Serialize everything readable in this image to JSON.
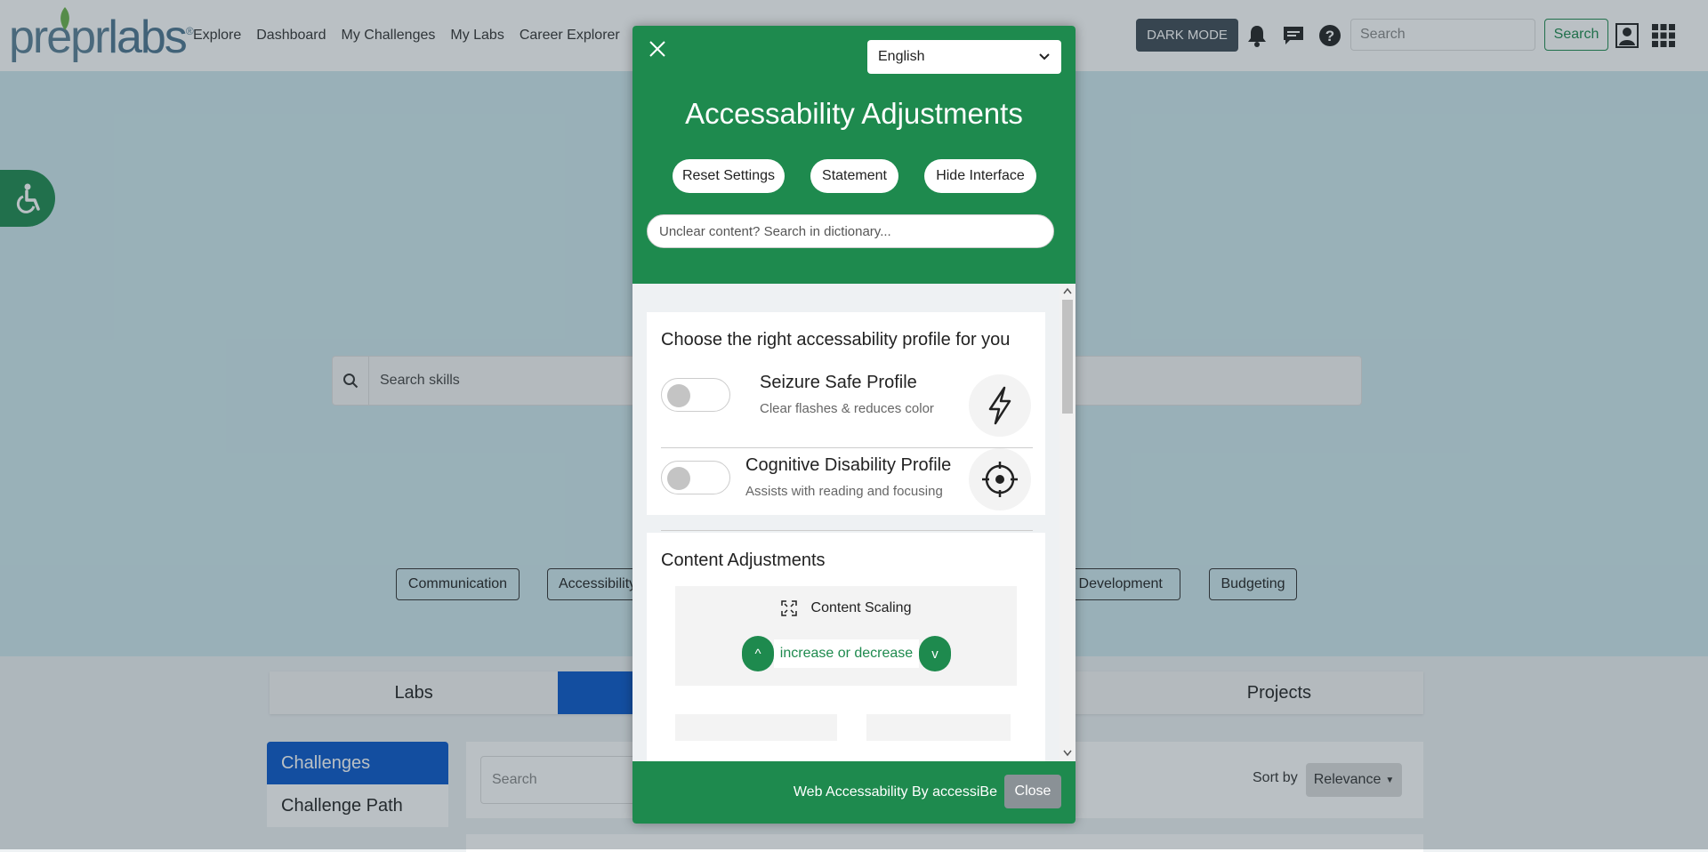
{
  "brand": {
    "logo_part1": "prepr",
    "logo_part2": "labs",
    "logo_reg": "®"
  },
  "nav": {
    "links": [
      "Explore",
      "Dashboard",
      "My Challenges",
      "My Labs",
      "Career Explorer"
    ],
    "dark_mode_label": "DARK MODE",
    "search_placeholder": "Search",
    "search_button": "Search",
    "icons": [
      "bell-icon",
      "chat-icon",
      "help-icon",
      "profile-icon",
      "apps-grid-icon"
    ]
  },
  "hero": {
    "skill_search_placeholder": "Search skills",
    "chips": [
      "Communication",
      "Accessibility",
      "d Development",
      "Budgeting"
    ]
  },
  "content": {
    "tabs": [
      "Labs",
      "",
      "",
      "Projects"
    ],
    "side_menu": [
      "Challenges",
      "Challenge Path"
    ],
    "filter_search_placeholder": "Search",
    "sort_label": "Sort by",
    "sort_value": "Relevance"
  },
  "panel": {
    "language": "English",
    "title": "Accessability Adjustments",
    "buttons": {
      "reset": "Reset Settings",
      "statement": "Statement",
      "hide": "Hide Interface"
    },
    "dictionary_placeholder": "Unclear content? Search in dictionary...",
    "profiles_heading": "Choose the right accessability profile for you",
    "profiles": [
      {
        "title": "Seizure Safe Profile",
        "subtitle": "Clear flashes & reduces color",
        "icon": "lightning-icon",
        "enabled": false
      },
      {
        "title": "Cognitive Disability Profile",
        "subtitle": "Assists with reading and focusing",
        "icon": "target-icon",
        "enabled": false
      }
    ],
    "content_heading": "Content Adjustments",
    "content_scaling": {
      "title": "Content Scaling",
      "increase": "^",
      "decrease": "v",
      "label": "increase or decrease"
    },
    "footer_text": "Web Accessability By accessiBe",
    "footer_close": "Close"
  },
  "colors": {
    "brand_green": "#1e8a4e",
    "tab_blue": "#0a58ca",
    "hero_bg": "#cfe8ee"
  }
}
